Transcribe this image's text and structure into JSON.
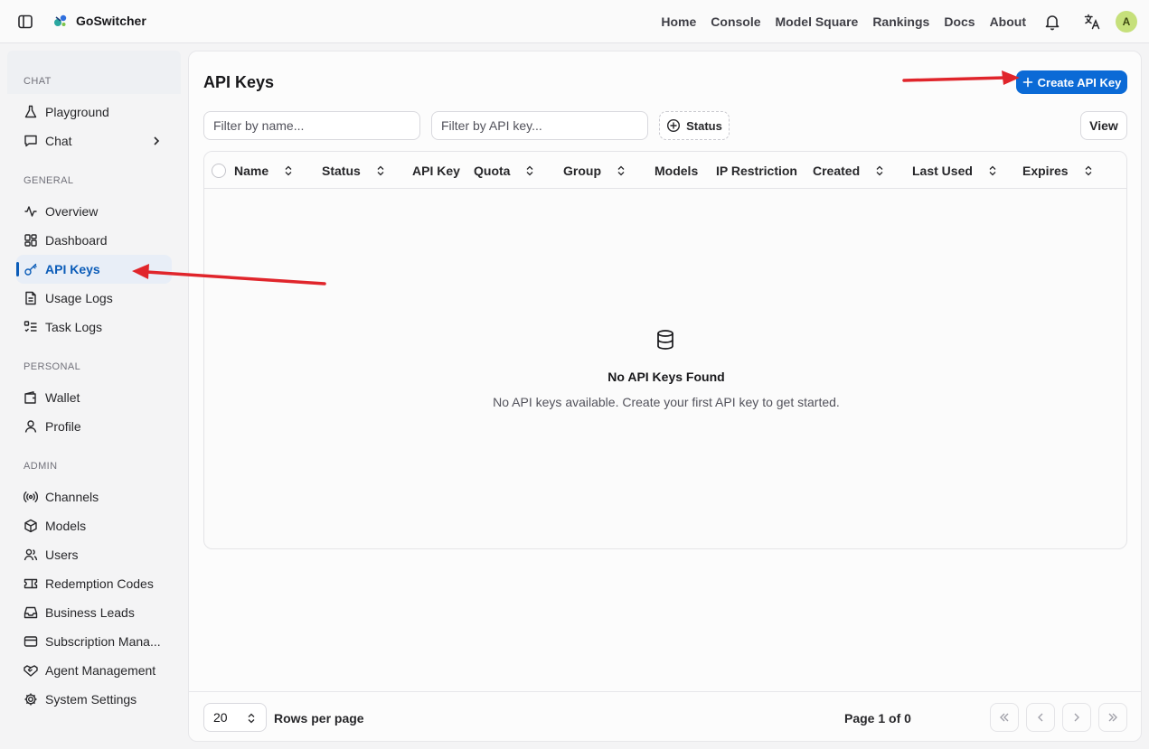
{
  "app": {
    "name": "GoSwitcher"
  },
  "topnav": {
    "items": [
      {
        "label": "Home"
      },
      {
        "label": "Console"
      },
      {
        "label": "Model Square"
      },
      {
        "label": "Rankings"
      },
      {
        "label": "Docs"
      },
      {
        "label": "About"
      }
    ],
    "avatar_initial": "A"
  },
  "sidebar": {
    "sections": [
      {
        "label": "CHAT",
        "items": [
          {
            "label": "Playground",
            "icon": "flask-icon"
          },
          {
            "label": "Chat",
            "icon": "chat-icon",
            "has_submenu": true
          }
        ]
      },
      {
        "label": "GENERAL",
        "items": [
          {
            "label": "Overview",
            "icon": "activity-icon"
          },
          {
            "label": "Dashboard",
            "icon": "dashboard-icon"
          },
          {
            "label": "API Keys",
            "icon": "key-icon",
            "active": true
          },
          {
            "label": "Usage Logs",
            "icon": "document-icon"
          },
          {
            "label": "Task Logs",
            "icon": "checklist-icon"
          }
        ]
      },
      {
        "label": "PERSONAL",
        "items": [
          {
            "label": "Wallet",
            "icon": "wallet-icon"
          },
          {
            "label": "Profile",
            "icon": "user-icon"
          }
        ]
      },
      {
        "label": "ADMIN",
        "items": [
          {
            "label": "Channels",
            "icon": "radio-icon"
          },
          {
            "label": "Models",
            "icon": "cube-icon"
          },
          {
            "label": "Users",
            "icon": "users-icon"
          },
          {
            "label": "Redemption Codes",
            "icon": "ticket-icon"
          },
          {
            "label": "Business Leads",
            "icon": "inbox-icon"
          },
          {
            "label": "Subscription Mana...",
            "icon": "credit-card-icon"
          },
          {
            "label": "Agent Management",
            "icon": "handshake-icon"
          },
          {
            "label": "System Settings",
            "icon": "gear-icon"
          }
        ]
      }
    ]
  },
  "main": {
    "title": "API Keys",
    "create_button": "Create API Key",
    "filter_name_placeholder": "Filter by name...",
    "filter_key_placeholder": "Filter by API key...",
    "status_button": "Status",
    "view_button": "View",
    "columns": [
      {
        "label": "Name",
        "sortable": true
      },
      {
        "label": "Status",
        "sortable": true
      },
      {
        "label": "API Key",
        "sortable": false
      },
      {
        "label": "Quota",
        "sortable": true
      },
      {
        "label": "Group",
        "sortable": true
      },
      {
        "label": "Models",
        "sortable": false
      },
      {
        "label": "IP Restriction",
        "sortable": false
      },
      {
        "label": "Created",
        "sortable": true
      },
      {
        "label": "Last Used",
        "sortable": true
      },
      {
        "label": "Expires",
        "sortable": true
      }
    ],
    "empty_title": "No API Keys Found",
    "empty_description": "No API keys available. Create your first API key to get started."
  },
  "pagination": {
    "rows_per_page_value": "20",
    "rows_per_page_label": "Rows per page",
    "page_info": "Page 1 of 0"
  },
  "colors": {
    "accent": "#0b6ad6",
    "active_text": "#0b5cb8",
    "annotation_arrow": "#e0252b"
  }
}
